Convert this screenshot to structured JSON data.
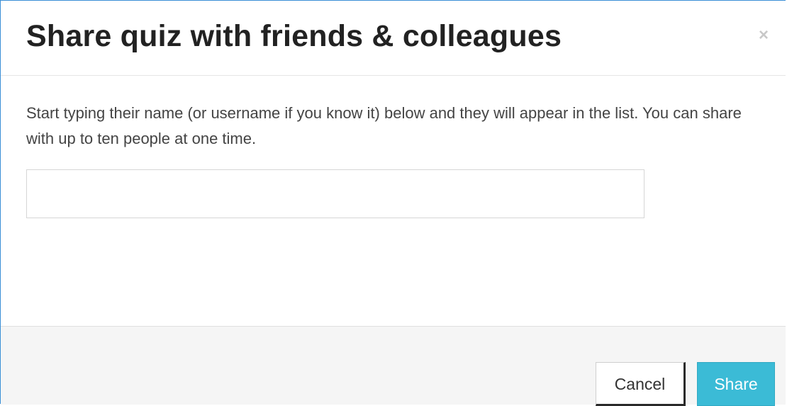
{
  "modal": {
    "title": "Share quiz with friends & colleagues",
    "close_label": "×",
    "instructions": "Start typing their name (or username if you know it) below and they will appear in the list. You can share with up to ten people at one time.",
    "input_value": "",
    "input_placeholder": "",
    "cancel_label": "Cancel",
    "share_label": "Share"
  },
  "colors": {
    "accent_border": "#3a8fd6",
    "share_button": "#3bbbd6",
    "footer_background": "#f5f5f5"
  }
}
